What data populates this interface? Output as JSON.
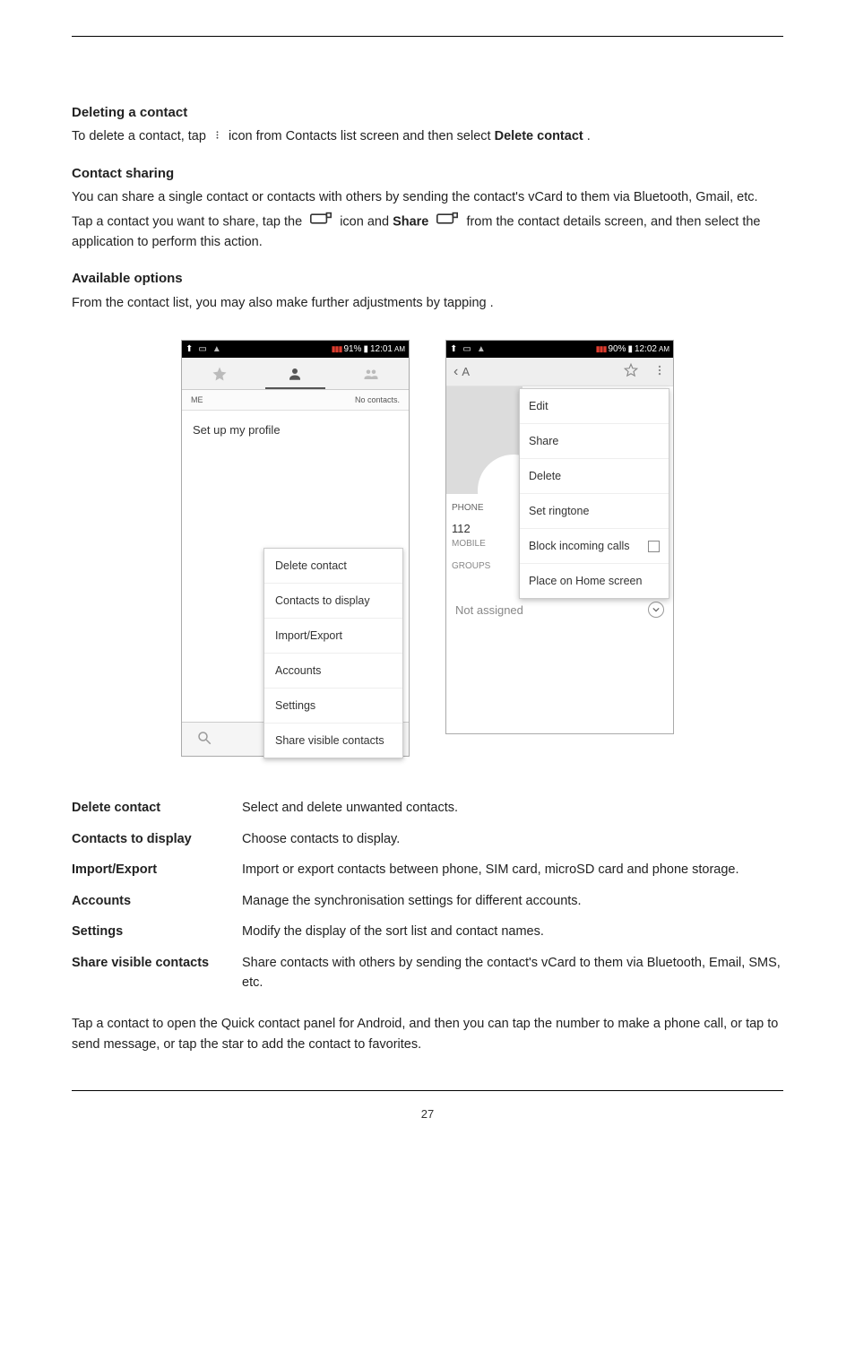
{
  "header_rule": true,
  "sections": {
    "deleting": {
      "title": "Deleting a contact",
      "line1_pre": "To delete a contact, tap ",
      "line1_icon_name": "menu-icon-small",
      "line1_post_a": " icon from Contacts list screen and then select ",
      "line1_bold": "Delete contact",
      "line1_end": "."
    },
    "sharing": {
      "title": "Contact sharing",
      "line1": "You can share a single contact or contacts with others by sending the contact's vCard to them via Bluetooth, Gmail, etc.",
      "line2_pre": "Tap a contact you want to share, tap the ",
      "line2_icon": "menu-icon-small",
      "line2_mid": " icon and ",
      "line2_bold": "Share",
      "line2_post": " from the contact details screen, and then select the application to perform this action."
    },
    "available": {
      "title": "Available options",
      "line": "From the contact list, you may also make further adjustments by tapping ."
    }
  },
  "screenshot1": {
    "status": {
      "battery": "91%",
      "time": "12:01",
      "ampm": "AM"
    },
    "me_label": "ME",
    "no_contacts": "No contacts.",
    "setup_profile": "Set up my profile",
    "menu": [
      "Delete contact",
      "Contacts to display",
      "Import/Export",
      "Accounts",
      "Settings",
      "Share visible contacts"
    ]
  },
  "screenshot2": {
    "status": {
      "battery": "90%",
      "time": "12:02",
      "ampm": "AM"
    },
    "back_label": "A",
    "phone_label": "PHONE",
    "number": "112",
    "mobile_label": "MOBILE",
    "groups_label": "GROUPS",
    "not_assigned": "Not assigned",
    "menu": {
      "edit": "Edit",
      "share": "Share",
      "delete": "Delete",
      "set_ringtone": "Set ringtone",
      "block": "Block incoming calls",
      "place_home": "Place on Home screen"
    }
  },
  "def_table": {
    "rows": [
      {
        "left": "Delete contact",
        "right": "Select and delete unwanted contacts."
      },
      {
        "left": "Contacts to display",
        "right": "Choose contacts to display."
      },
      {
        "left": "Import/Export",
        "right": "Import or export contacts between phone, SIM card, microSD card and phone storage."
      },
      {
        "left": "Accounts",
        "right": "Manage the synchronisation settings for different accounts."
      },
      {
        "left": "Settings",
        "right": "Modify the display of the sort list and contact names."
      },
      {
        "left": "Share visible contacts",
        "right": "Share contacts with others by sending the contact's vCard to them via Bluetooth, Email, SMS, etc."
      }
    ]
  },
  "bottom_para": "Tap a contact to open the Quick contact panel for Android, and then you can tap the number to make a phone call, or tap to send message, or tap the star to add the contact to favorites.",
  "page_number": "27"
}
